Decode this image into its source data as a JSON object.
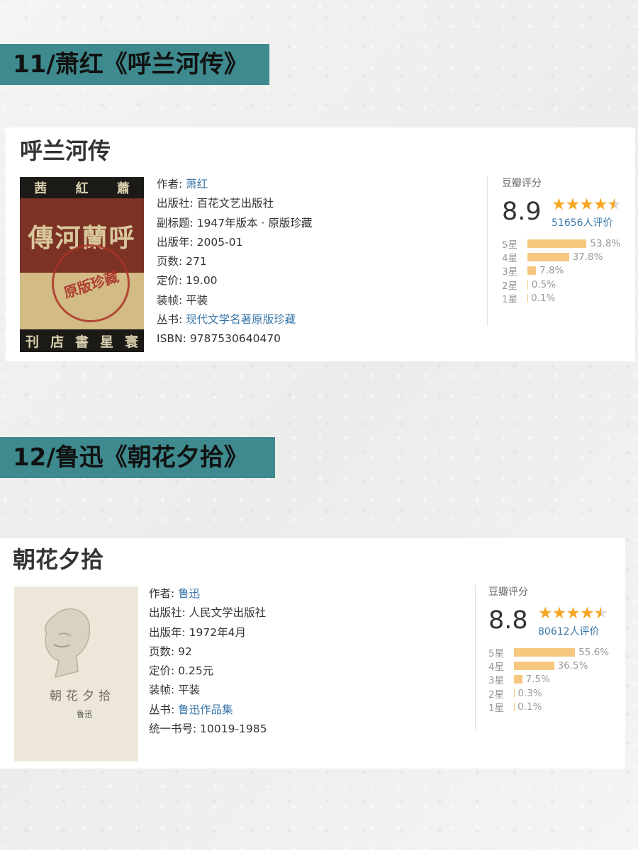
{
  "sections": [
    {
      "banner": "11/萧红《呼兰河传》",
      "book": {
        "title": "呼兰河传",
        "cover": {
          "top_chars": [
            "茜",
            "紅",
            "蕭"
          ],
          "main_text": "傳河蘭呼",
          "stamp_text": "原版珍藏",
          "bottom_chars": [
            "刊",
            "店",
            "書",
            "星",
            "寰"
          ]
        },
        "info": [
          {
            "key": "作者:",
            "value": "萧红",
            "link": true
          },
          {
            "key": "出版社:",
            "value": "百花文艺出版社",
            "link": false
          },
          {
            "key": "副标题:",
            "value": "1947年版本 · 原版珍藏",
            "link": false
          },
          {
            "key": "出版年:",
            "value": "2005-01",
            "link": false
          },
          {
            "key": "页数:",
            "value": "271",
            "link": false
          },
          {
            "key": "定价:",
            "value": "19.00",
            "link": false
          },
          {
            "key": "装帧:",
            "value": "平装",
            "link": false
          },
          {
            "key": "丛书:",
            "value": "现代文学名著原版珍藏",
            "link": true
          },
          {
            "key": "ISBN:",
            "value": "9787530640470",
            "link": false
          }
        ],
        "rating": {
          "label": "豆瓣评分",
          "score": "8.9",
          "stars": 4.5,
          "count": "51656人评价",
          "distribution": [
            {
              "label": "5星",
              "pct": "53.8%",
              "value": 53.8
            },
            {
              "label": "4星",
              "pct": "37.8%",
              "value": 37.8
            },
            {
              "label": "3星",
              "pct": "7.8%",
              "value": 7.8
            },
            {
              "label": "2星",
              "pct": "0.5%",
              "value": 0.5
            },
            {
              "label": "1星",
              "pct": "0.1%",
              "value": 0.1
            }
          ]
        }
      }
    },
    {
      "banner": "12/鲁迅《朝花夕拾》",
      "book": {
        "title": "朝花夕拾",
        "cover": {
          "title_text": "朝花夕拾",
          "sign_text": "鲁迅"
        },
        "info": [
          {
            "key": "作者:",
            "value": "鲁迅",
            "link": true
          },
          {
            "key": "出版社:",
            "value": "人民文学出版社",
            "link": false
          },
          {
            "key": "出版年:",
            "value": "1972年4月",
            "link": false
          },
          {
            "key": "页数:",
            "value": "92",
            "link": false
          },
          {
            "key": "定价:",
            "value": "0.25元",
            "link": false
          },
          {
            "key": "装帧:",
            "value": "平装",
            "link": false
          },
          {
            "key": "丛书:",
            "value": "鲁迅作品集",
            "link": true
          },
          {
            "key": "统一书号:",
            "value": "10019-1985",
            "link": false
          }
        ],
        "rating": {
          "label": "豆瓣评分",
          "score": "8.8",
          "stars": 4.5,
          "count": "80612人评价",
          "distribution": [
            {
              "label": "5星",
              "pct": "55.6%",
              "value": 55.6
            },
            {
              "label": "4星",
              "pct": "36.5%",
              "value": 36.5
            },
            {
              "label": "3星",
              "pct": "7.5%",
              "value": 7.5
            },
            {
              "label": "2星",
              "pct": "0.3%",
              "value": 0.3
            },
            {
              "label": "1星",
              "pct": "0.1%",
              "value": 0.1
            }
          ]
        }
      }
    }
  ],
  "colors": {
    "banner": "#3e8a8e",
    "link": "#3a77a8",
    "star": "#f5a623",
    "bar": "#f6c77f"
  }
}
